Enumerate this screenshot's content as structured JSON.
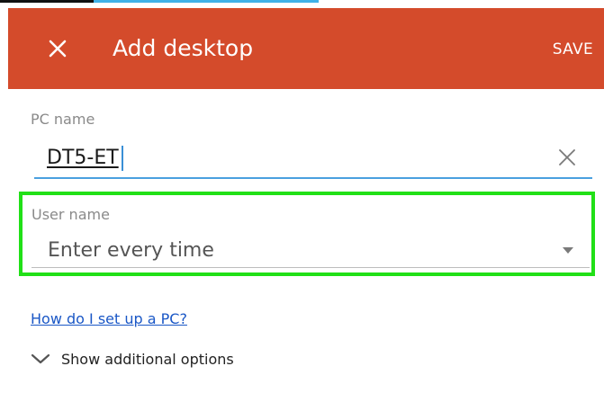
{
  "app_bar": {
    "title": "Add desktop",
    "save_label": "SAVE",
    "background_color": "#d44b2b",
    "close_icon": "close-icon"
  },
  "form": {
    "pc_name": {
      "label": "PC name",
      "value": "DT5-ET",
      "clear_icon": "close-icon"
    },
    "user_name": {
      "label": "User name",
      "value": "Enter every time",
      "dropdown_icon": "dropdown-arrow-icon"
    }
  },
  "help_link": "How do I set up a PC?",
  "additional_options": {
    "label": "Show additional options",
    "icon": "chevron-down-icon"
  },
  "colors": {
    "highlight": "#21e017",
    "focus_underline": "#4aa0df",
    "link": "#1a57c6"
  }
}
